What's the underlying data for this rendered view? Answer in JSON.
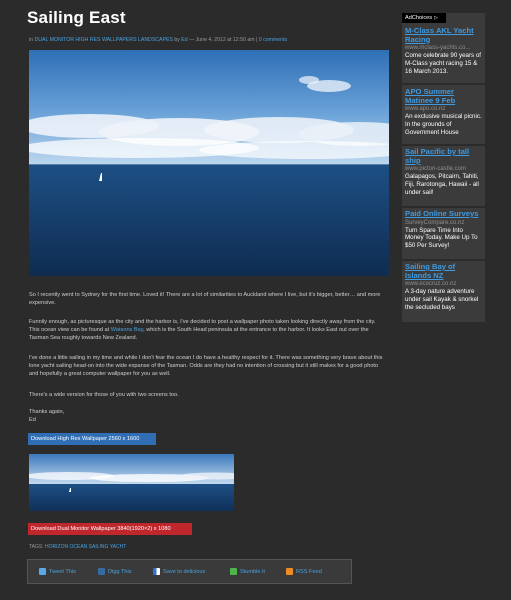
{
  "post": {
    "title": "Sailing East",
    "meta_in": "in",
    "category": "DUAL MONITOR HIGH RES WALLPAPERS LANDSCAPES",
    "meta_by": "by",
    "author": "Ed",
    "meta_date": "— June 4, 2012 at 12:50 am |",
    "comments": "0 comments",
    "p1": "So I recently went to Sydney for the first time. Loved it! There are a lot of similarities to Auckland where I live, but it's bigger, better… and more expensive.",
    "p2_before": "Funnily enough, as picturesque as the city and the harbor is, I've decided to post a wallpaper photo taken looking directly away from the city. This ocean view can be found at",
    "p2_link": "Watsons Bay",
    "p2_after": ", which is the South Head peninsula at the entrance to the harbor. It looks East out over the Tasman Sea roughly towards New Zealand.",
    "p3": "I've done a little sailing in my time and while I don't fear the ocean I do have a healthy respect for it. There was something very brave about this lone yacht sailing head-on into the wide expanse of the Tasman. Odds are they had no intention of crossing but it still makes for a good photo and hopefully a great computer wallpaper for you as well.",
    "p4": "There's a wide version for those of you with two screens too.",
    "p5_line1": "Thanks again,",
    "p5_line2": "Ed",
    "download_hires": "Download High Res Wallpaper 2560 x 1600",
    "download_dual": "Download Dual Monitor Wallpaper 3840(1920×2) x 1080",
    "tags_label": "TAGS:",
    "tags": [
      "HORIZON",
      "OCEAN",
      "SAILING",
      "YACHT"
    ]
  },
  "share": [
    {
      "label": "Tweet This",
      "icon": "twitter-icon",
      "color": "#5aa9e6"
    },
    {
      "label": "Digg This",
      "icon": "digg-icon",
      "color": "#356aa0"
    },
    {
      "label": "Save to delicious",
      "icon": "delicious-icon",
      "color": "#3274d1"
    },
    {
      "label": "Stumble it",
      "icon": "stumbleupon-icon",
      "color": "#4bb44a"
    },
    {
      "label": "RSS Feed",
      "icon": "rss-icon",
      "color": "#f08a24"
    }
  ],
  "ads": {
    "choices_label": "AdChoices",
    "items": [
      {
        "title": "M-Class AKL Yacht Racing",
        "url": "www.mclass-yachts.co...",
        "desc": "Come celebrate 90 years of M-Class yacht racing 15 & 16 March 2013."
      },
      {
        "title": "APO Summer Matinee 9 Feb",
        "url": "www.apo.co.nz",
        "desc": "An exclusive musical picnic. In the grounds of Government House"
      },
      {
        "title": "Sail Pacific by tall ship",
        "url": "www.picton-castle.com",
        "desc": "Galapagos, Pitcairn, Tahiti, Fiji, Rarotonga, Hawaii - all under sail!"
      },
      {
        "title": "Paid Online Surveys",
        "url": "SurveyCompare.co.nz",
        "desc": "Turn Spare Time Into Money Today. Make Up To $50 Per Survey!"
      },
      {
        "title": "Sailing Bay of Islands NZ",
        "url": "www.ecocruz.co.nz",
        "desc": "A 3-day nature adventure under sail Kayak & snorkel the secluded bays"
      }
    ]
  }
}
